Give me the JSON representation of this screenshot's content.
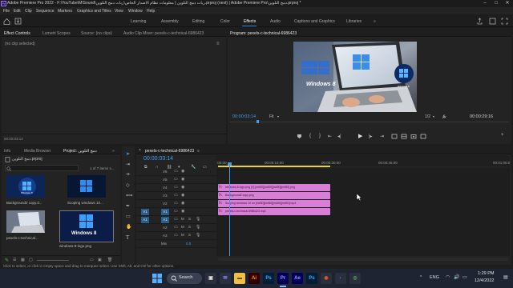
{
  "window": {
    "title": "Adobe Premiere Pro 2022 - F:\\YouTube\\M\\Sound\\ربات دمج التلوين | معلومات نظام الاصدار الخاص\\ربات دمج التلوين.prproj (next) | Adobe Premiere Pro\\دمج التلوين.prproj *",
    "app_badge": "Pr",
    "controls": [
      "–",
      "□",
      "✕"
    ]
  },
  "menu": [
    "File",
    "Edit",
    "Clip",
    "Sequence",
    "Markers",
    "Graphics and Titles",
    "View",
    "Window",
    "Help"
  ],
  "workspaces": {
    "items": [
      "Learning",
      "Assembly",
      "Editing",
      "Color",
      "Effects",
      "Audio",
      "Captions and Graphics",
      "Libraries"
    ],
    "active": "Effects",
    "more": "»"
  },
  "source_panel": {
    "tabs": [
      "Effect Controls",
      "Lumetri Scopes",
      "Source: (no clips)",
      "Audio Clip Mixer: pexels-c-technical-6986423"
    ],
    "menu_icon": "≡",
    "message": "(no clip selected)",
    "timecode": "00:00:03:14"
  },
  "program_panel": {
    "tab": "Program: pexels-c-technical-6986423",
    "menu_icon": "≡",
    "timecode": "00:00:03:14",
    "fit": "Fit",
    "resolution": "1/2",
    "duration": "00:00:29:16",
    "video_text": "Windows 8",
    "video_badge": "Windows 8"
  },
  "project_panel": {
    "tabs": [
      "Info",
      "Media Browser",
      "Project: دمج التلوين"
    ],
    "more": "»",
    "filename": "دمج التلوين.prproj",
    "item_count": "1 of 7 items s...",
    "search_placeholder": "",
    "items": [
      {
        "label": "Background2 copy.d...",
        "color": "#4a8fd8",
        "badge": "Windows 8"
      },
      {
        "label": "Scoping windows 10...",
        "color": "#4a8fd8",
        "badge": ""
      },
      {
        "label": "pexels-c-technical...",
        "color": "#8e8eb4",
        "badge": ""
      },
      {
        "label": "windows-8-logo.png",
        "color": "#4a8fd8",
        "badge": "Windows 8"
      }
    ]
  },
  "timeline": {
    "tab": "pexels-c-technical-6986423",
    "menu_icon": "≡",
    "timecode": "00:00:03:14",
    "ruler": [
      ":00:00",
      "00:00:15:00",
      "00:00:30:00",
      "00:00:45:00",
      "00:01:00:0"
    ],
    "video_tracks": [
      "V6",
      "V5",
      "V4",
      "V3",
      "V2",
      "V1"
    ],
    "audio_tracks": [
      "A1",
      "A2",
      "A3"
    ],
    "mix_label": "Mix",
    "mix_value": "0.0",
    "source_patch_v": "V1",
    "source_patch_a": "A1",
    "clips": [
      {
        "track": "V4",
        "label": "windows-8-logo.png [V] [m#00][m#50][m#50][m#50].png",
        "type": "video"
      },
      {
        "track": "V3",
        "label": "Background2 copy.png",
        "type": "video"
      },
      {
        "track": "V2",
        "label": "Scoping windows 10 on [m#50][m#50][m#50][m#50].mp4",
        "type": "video"
      },
      {
        "track": "V1",
        "label": "pexels-c-technical-6986423.mp4",
        "type": "video"
      }
    ],
    "fx_marker": "fx"
  },
  "status_bar": {
    "text": "Click to select, or click in empty space and drag to marquee select. Use Shift, Alt, and Ctrl for other options."
  },
  "taskbar": {
    "search_label": "Search",
    "language": "ENG",
    "time": "1:29 PM",
    "date": "12/4/2022",
    "apps": [
      "Ai",
      "Ps",
      "Pr",
      "Ae",
      "Ps"
    ]
  },
  "colors": {
    "accent": "#2d8ceb",
    "playhead": "#3e9cf4",
    "video_clip": "#d97ed6",
    "audio_clip": "#7fc18a"
  }
}
